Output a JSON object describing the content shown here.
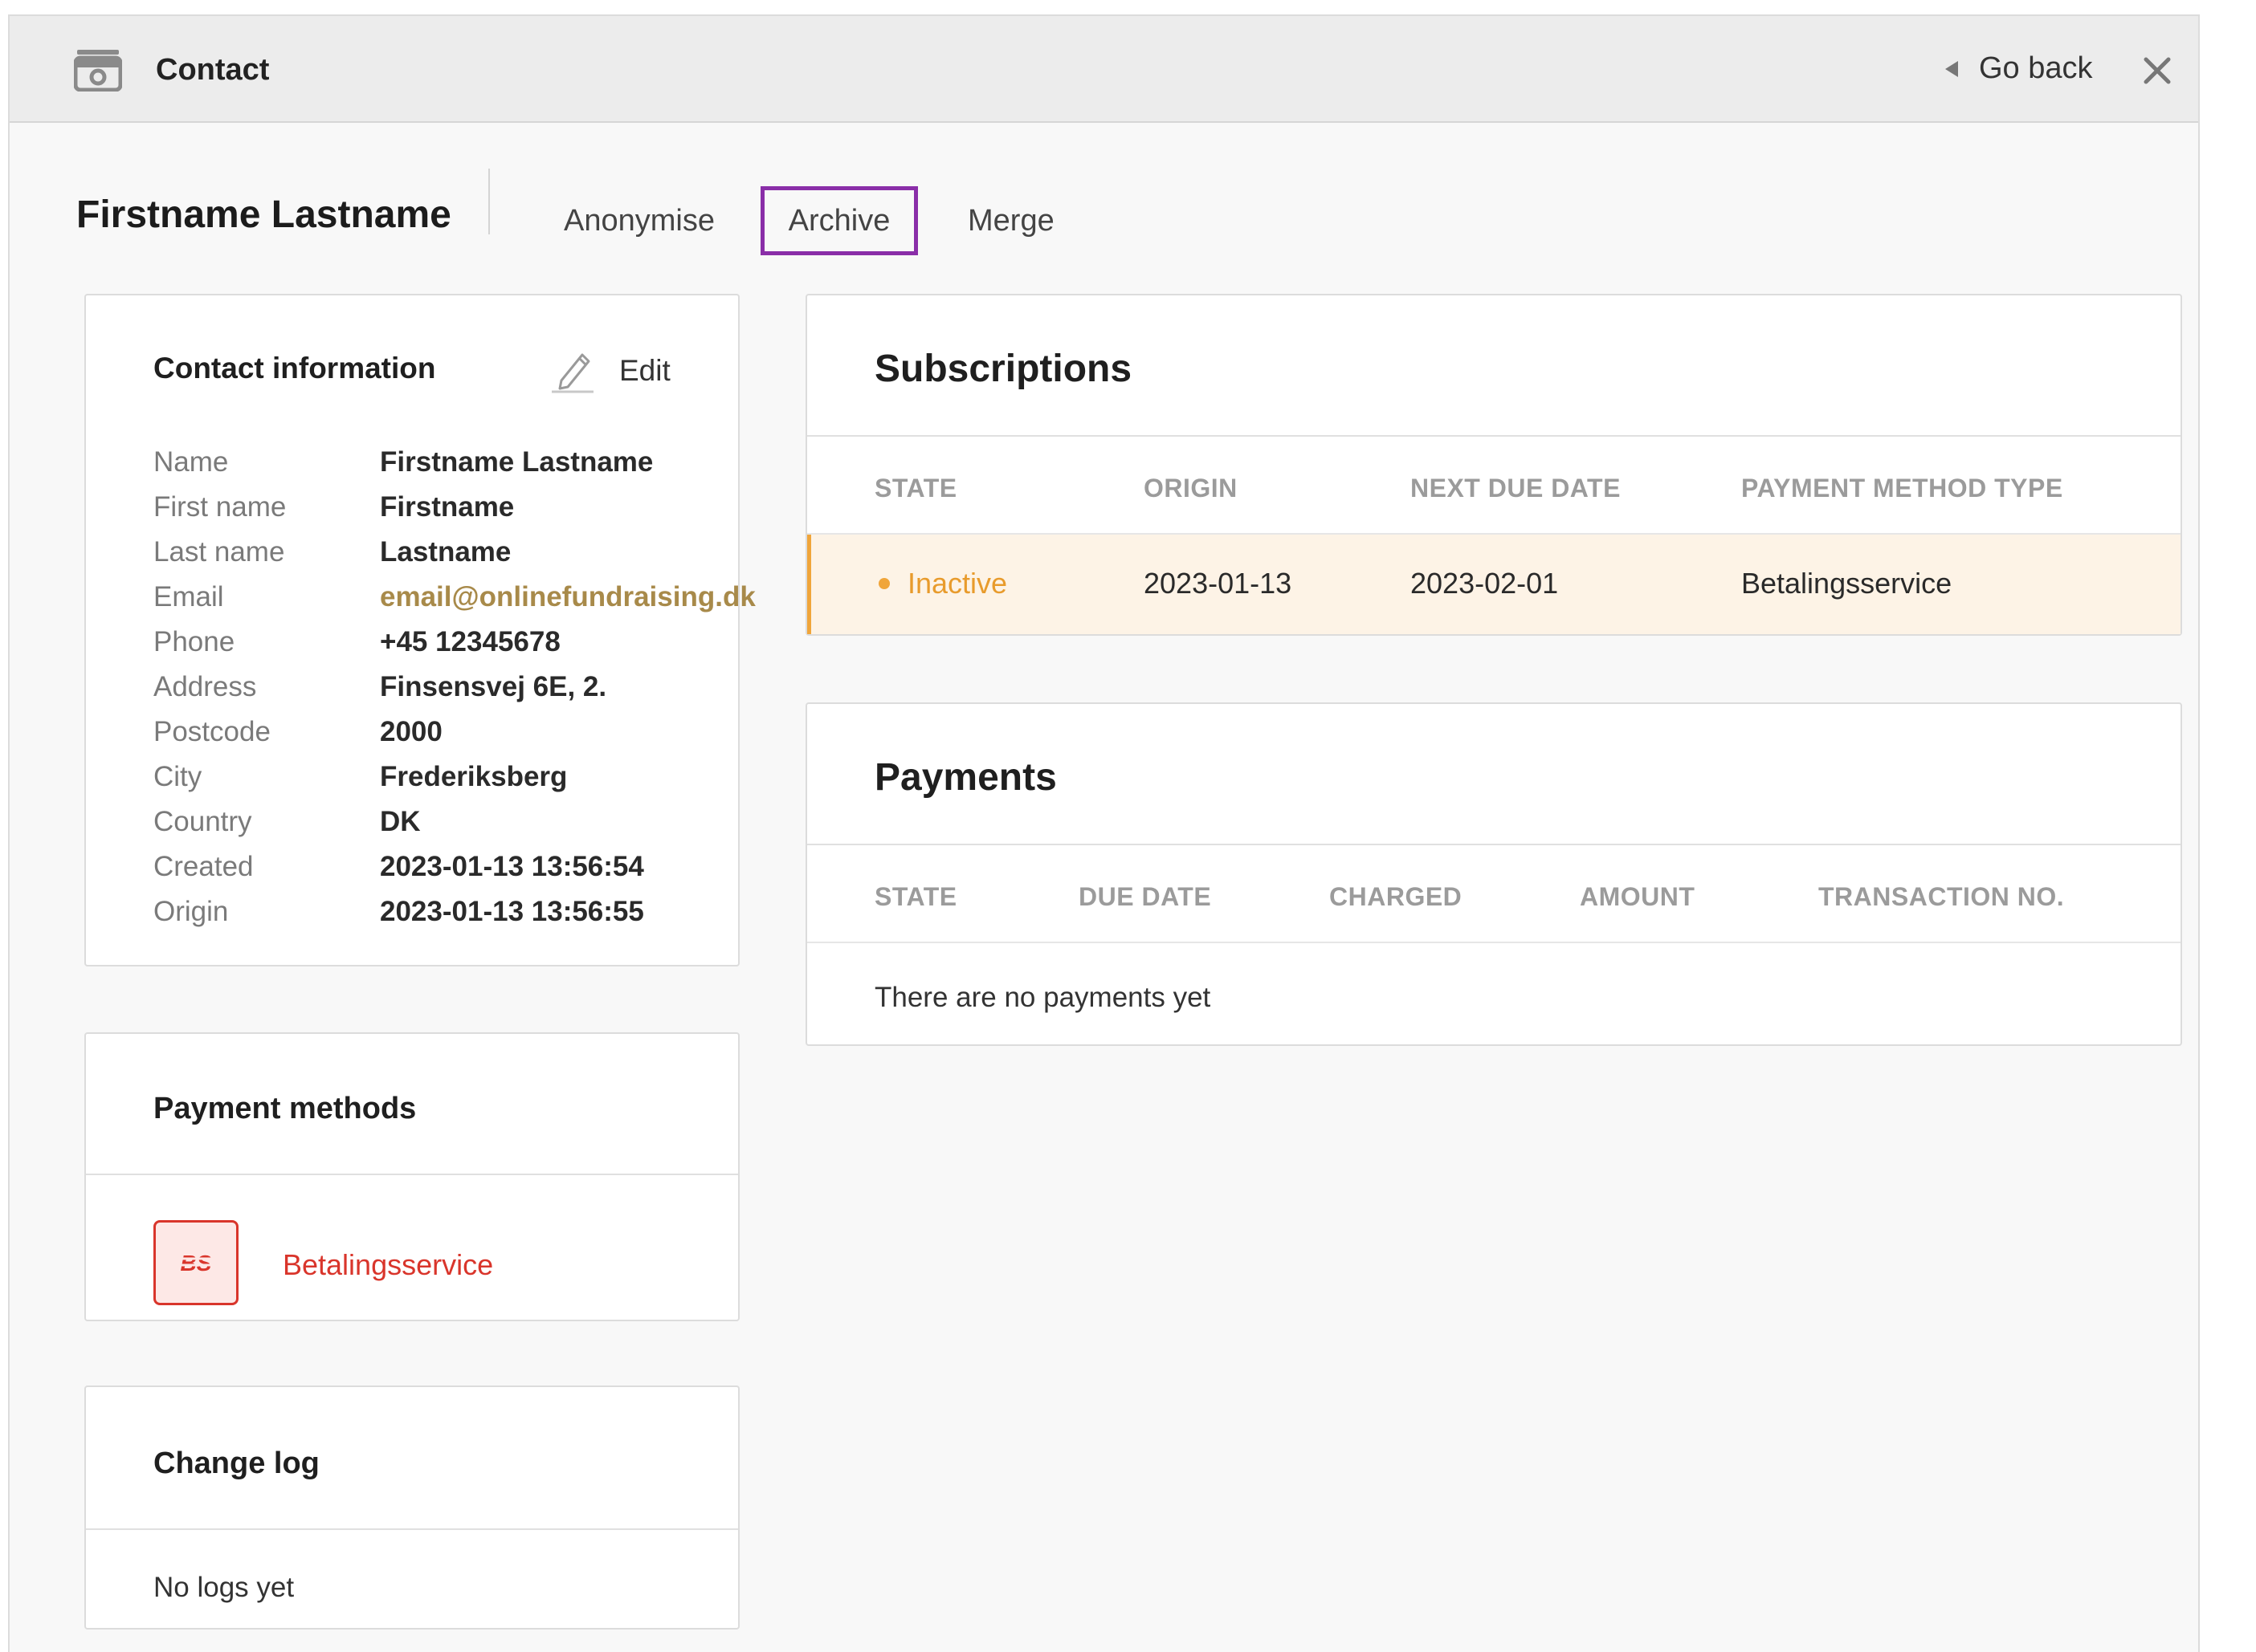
{
  "topbar": {
    "title": "Contact",
    "go_back_label": "Go back"
  },
  "contact": {
    "name": "Firstname Lastname",
    "actions": {
      "anonymise": "Anonymise",
      "archive": "Archive",
      "merge": "Merge"
    }
  },
  "contact_info": {
    "heading": "Contact information",
    "edit_label": "Edit",
    "rows": [
      {
        "label": "Name",
        "value": "Firstname Lastname"
      },
      {
        "label": "First name",
        "value": "Firstname"
      },
      {
        "label": "Last name",
        "value": "Lastname"
      },
      {
        "label": "Email",
        "value": "email@onlinefundraising.dk"
      },
      {
        "label": "Phone",
        "value": "+45 12345678"
      },
      {
        "label": "Address",
        "value": "Finsensvej 6E, 2."
      },
      {
        "label": "Postcode",
        "value": "2000"
      },
      {
        "label": "City",
        "value": "Frederiksberg"
      },
      {
        "label": "Country",
        "value": "DK"
      },
      {
        "label": "Created",
        "value": "2023-01-13 13:56:54"
      },
      {
        "label": "Origin",
        "value": "2023-01-13 13:56:55"
      }
    ]
  },
  "payment_methods": {
    "heading": "Payment methods",
    "items": [
      {
        "label": "Betalingsservice",
        "logo_text": "BS"
      }
    ]
  },
  "change_log": {
    "heading": "Change log",
    "empty_text": "No logs yet"
  },
  "subscriptions": {
    "heading": "Subscriptions",
    "columns": [
      "STATE",
      "ORIGIN",
      "NEXT DUE DATE",
      "PAYMENT METHOD TYPE"
    ],
    "rows": [
      {
        "state": "Inactive",
        "origin": "2023-01-13",
        "next_due_date": "2023-02-01",
        "payment_method_type": "Betalingsservice"
      }
    ]
  },
  "payments": {
    "heading": "Payments",
    "columns": [
      "STATE",
      "DUE DATE",
      "CHARGED",
      "AMOUNT",
      "TRANSACTION NO."
    ],
    "empty_text": "There are no payments yet"
  },
  "colors": {
    "archive_highlight": "#8a2ea8",
    "inactive_state": "#e89b2c",
    "betalingsservice_red": "#d9352b",
    "email_link": "#a88a4a"
  }
}
